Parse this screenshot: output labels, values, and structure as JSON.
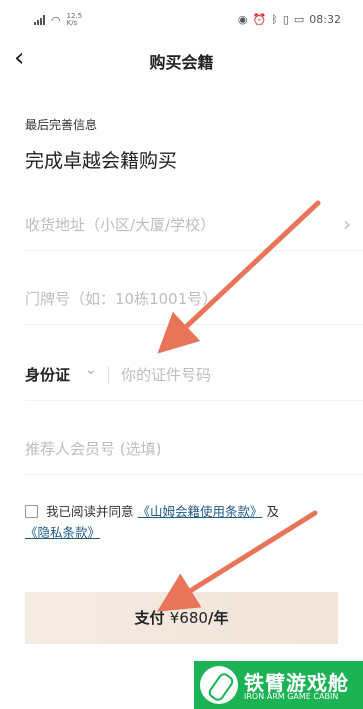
{
  "status_bar": {
    "network_speed": "12.5",
    "network_unit": "K/s",
    "time": "08:32"
  },
  "header": {
    "title": "购买会籍"
  },
  "form": {
    "section_label": "最后完善信息",
    "heading": "完成卓越会籍购买",
    "address_placeholder": "收货地址（小区/大厦/学校）",
    "unit_placeholder": "门牌号（如：10栋1001号）",
    "id_type": "身份证",
    "id_placeholder": "你的证件号码",
    "referrer_placeholder": "推荐人会员号 (选填)"
  },
  "agreement": {
    "prefix": "我已阅读并同意",
    "terms_link": "《山姆会籍使用条款》",
    "connector": "及",
    "privacy_link": "《隐私条款》"
  },
  "pay_button": {
    "label": "支付",
    "price": "¥680",
    "unit": "/年"
  },
  "watermark": {
    "cn": "铁臂游戏舱",
    "en": "IRON ARM GAME CABIN"
  },
  "colors": {
    "link": "#1f5b8a",
    "pay_bg": "#f4ebe3",
    "annotation_arrow": "#e8755a",
    "watermark_bg": "#1cb355"
  }
}
